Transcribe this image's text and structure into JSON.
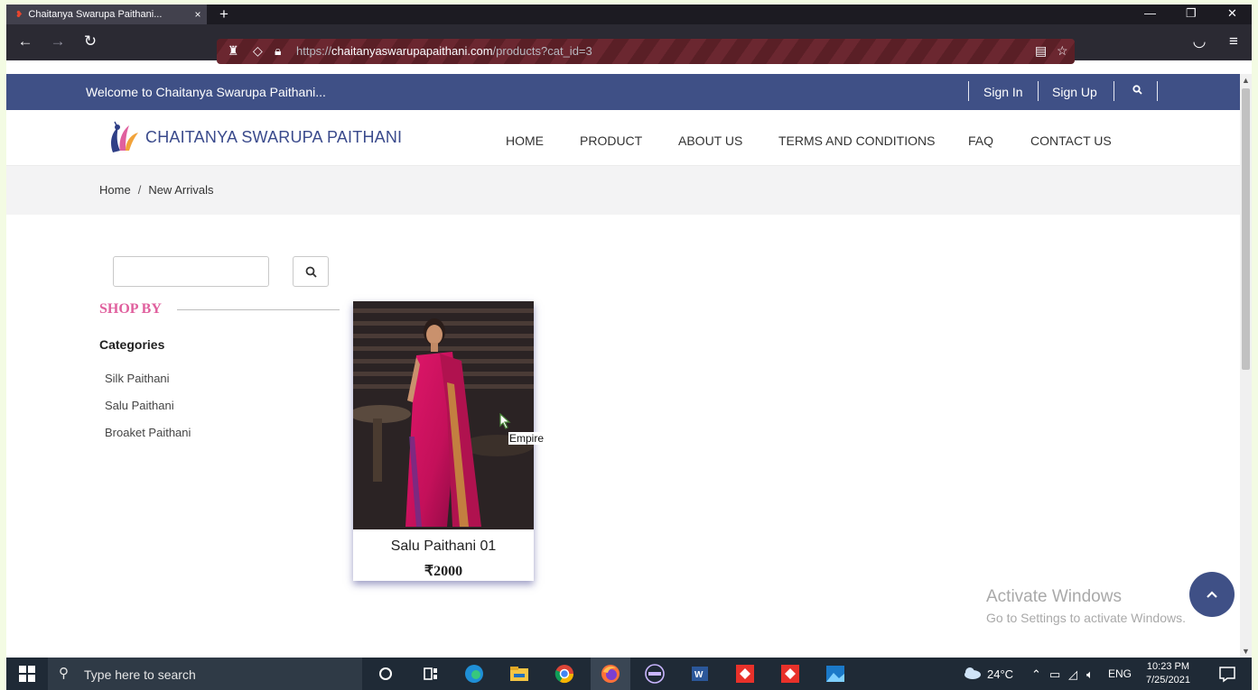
{
  "browser": {
    "tab_title": "Chaitanya Swarupa Paithani...",
    "tab_close": "×",
    "new_tab": "+",
    "url_prefix": "https://",
    "url_host": "chaitanyaswarupapaithani.com",
    "url_path": "/products?cat_id=3"
  },
  "topbar": {
    "welcome": "Welcome to Chaitanya Swarupa Paithani...",
    "sign_in": "Sign In",
    "sign_up": "Sign Up"
  },
  "header": {
    "brand": "CHAITANYA SWARUPA PAITHANI",
    "menu": [
      "HOME",
      "PRODUCT",
      "ABOUT US",
      "TERMS AND CONDITIONS",
      "FAQ",
      "CONTACT US"
    ]
  },
  "breadcrumb": {
    "home": "Home",
    "separator": "/",
    "current": "New Arrivals"
  },
  "sidebar": {
    "search_value": "",
    "shop_by": "SHOP BY",
    "categories_heading": "Categories",
    "categories": [
      "Silk Paithani",
      "Salu Paithani",
      "Broaket Paithani"
    ]
  },
  "products": [
    {
      "name": "Salu Paithani 01",
      "price": "₹2000"
    }
  ],
  "tooltip": "Empire",
  "watermark": {
    "line1": "Activate Windows",
    "line2": "Go to Settings to activate Windows."
  },
  "taskbar": {
    "search_placeholder": "Type here to search",
    "weather": "24°C",
    "language": "ENG",
    "time": "10:23 PM",
    "date": "7/25/2021"
  },
  "colors": {
    "site_primary": "#3f5086",
    "shop_by_accent": "#e0609e",
    "browser_chrome": "#2b2a33",
    "taskbar": "#1f2a36"
  }
}
